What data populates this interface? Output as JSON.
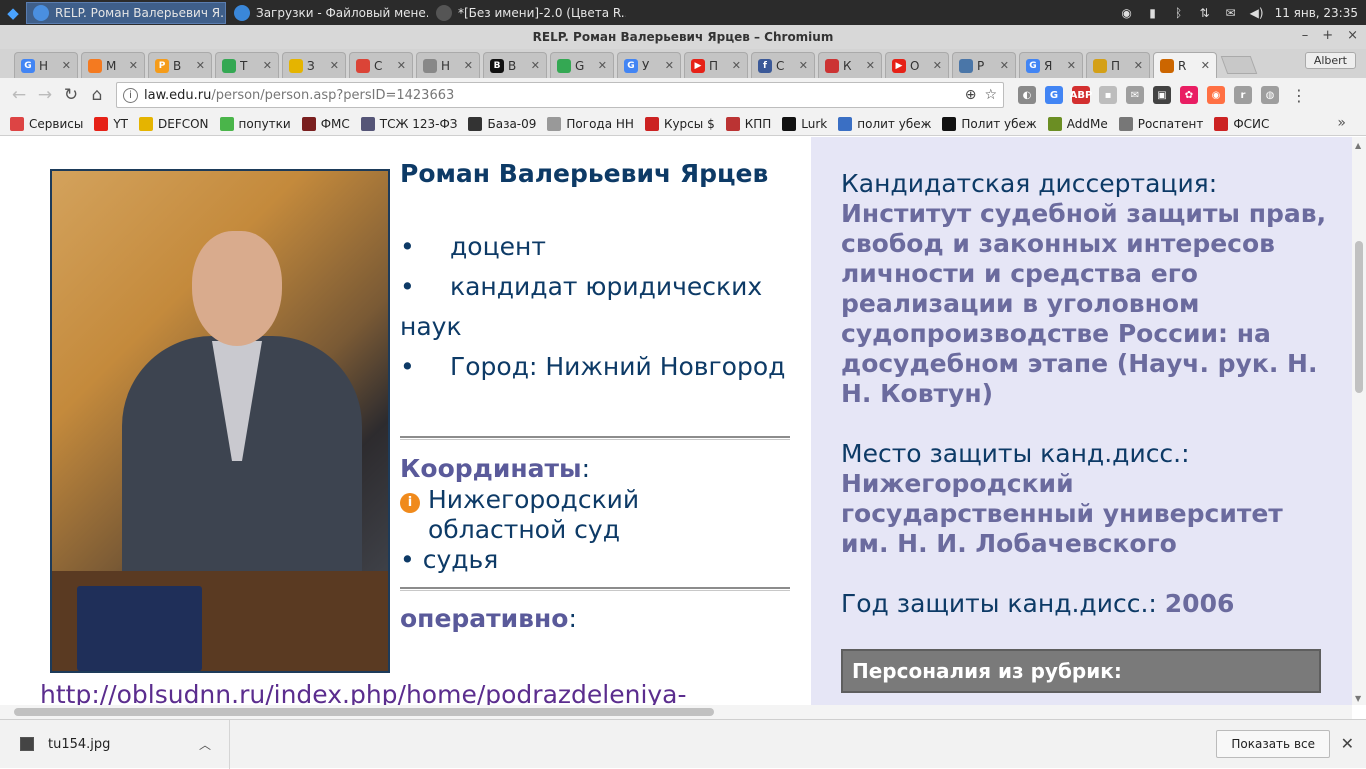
{
  "taskbar": {
    "tasks": [
      {
        "label": "RELP. Роман Валерьевич Я...",
        "active": true,
        "color": "#4a8fe0"
      },
      {
        "label": "Загрузки - Файловый мене...",
        "active": false,
        "color": "#3a87d9"
      },
      {
        "label": "*[Без имени]-2.0 (Цвета R...",
        "active": false,
        "color": "#555555"
      }
    ],
    "clock": "11 янв, 23:35"
  },
  "window": {
    "title": "RELP. Роман Валерьевич Ярцев – Chromium",
    "min": "–",
    "max": "+",
    "close": "×"
  },
  "tabs": [
    {
      "label": "Н",
      "fav": "G",
      "color": "#4285f4"
    },
    {
      "label": "М",
      "fav": "",
      "color": "#f47a20"
    },
    {
      "label": "В",
      "fav": "P",
      "color": "#f59c1a"
    },
    {
      "label": "Т",
      "fav": "",
      "color": "#34a853"
    },
    {
      "label": "З",
      "fav": "",
      "color": "#e5b400"
    },
    {
      "label": "С",
      "fav": "",
      "color": "#db4437"
    },
    {
      "label": "Н",
      "fav": "",
      "color": "#888888"
    },
    {
      "label": "В",
      "fav": "B",
      "color": "#111111"
    },
    {
      "label": "G",
      "fav": "",
      "color": "#34a853"
    },
    {
      "label": "У",
      "fav": "G",
      "color": "#4285f4"
    },
    {
      "label": "П",
      "fav": "▶",
      "color": "#e62117"
    },
    {
      "label": "С",
      "fav": "f",
      "color": "#3b5998"
    },
    {
      "label": "К",
      "fav": "",
      "color": "#cc3333"
    },
    {
      "label": "О",
      "fav": "▶",
      "color": "#e62117"
    },
    {
      "label": "Р",
      "fav": "",
      "color": "#4a76a8"
    },
    {
      "label": "Я",
      "fav": "G",
      "color": "#4285f4"
    },
    {
      "label": "П",
      "fav": "",
      "color": "#d4a017"
    },
    {
      "label": "R",
      "fav": "",
      "color": "#cc6600",
      "active": true
    }
  ],
  "profile": "Albert",
  "omnibox": {
    "host": "law.edu.ru",
    "path": "/person/person.asp?persID=1423663"
  },
  "bookmarks": [
    {
      "label": "Сервисы",
      "color": "#d44"
    },
    {
      "label": "YT",
      "color": "#e62117"
    },
    {
      "label": "DEFCON",
      "color": "#e5b400"
    },
    {
      "label": "попутки",
      "color": "#4ab54a"
    },
    {
      "label": "ФМС",
      "color": "#7a1f1f"
    },
    {
      "label": "ТСЖ 123-ФЗ",
      "color": "#557"
    },
    {
      "label": "База-09",
      "color": "#333"
    },
    {
      "label": "Погода НН",
      "color": "#999"
    },
    {
      "label": "Курсы $",
      "color": "#c22"
    },
    {
      "label": "КПП",
      "color": "#b33"
    },
    {
      "label": "Lurk",
      "color": "#111"
    },
    {
      "label": "полит убеж",
      "color": "#3a6fc4"
    },
    {
      "label": "Полит убеж",
      "color": "#111"
    },
    {
      "label": "AddMe",
      "color": "#6b8e23"
    },
    {
      "label": "Роспатент",
      "color": "#777"
    },
    {
      "label": "ФСИС",
      "color": "#c22"
    }
  ],
  "person": {
    "name": "Роман Валерьевич Ярцев",
    "bullets": [
      "доцент",
      "кандидат юридических наук",
      "Город: Нижний Новгород"
    ],
    "coords_label": "Координаты",
    "org": "Нижегородский областной суд",
    "role": "• судья",
    "operative_label": "оперативно",
    "link": "http://oblsudnn.ru/index.php/home/podrazdeleniya-"
  },
  "dissertation": {
    "cand_label": "Кандидатская диссертация:",
    "cand_title": "Институт судебной защиты прав, свобод и законных интересов личности и средства его реализации в уголовном судопроизводстве России: на досудебном этапе (Науч. рук. Н. Н. Ковтун)",
    "place_label": "Место защиты канд.дисс.:",
    "place_value": "Нижегородский государственный университет им. Н. И. Лобачевского",
    "year_label": "Год защиты канд.дисс.:",
    "year_value": "2006",
    "rubric_title": "Персоналия из рубрик:"
  },
  "downloads": {
    "file": "tu154.jpg",
    "show_all": "Показать все"
  }
}
